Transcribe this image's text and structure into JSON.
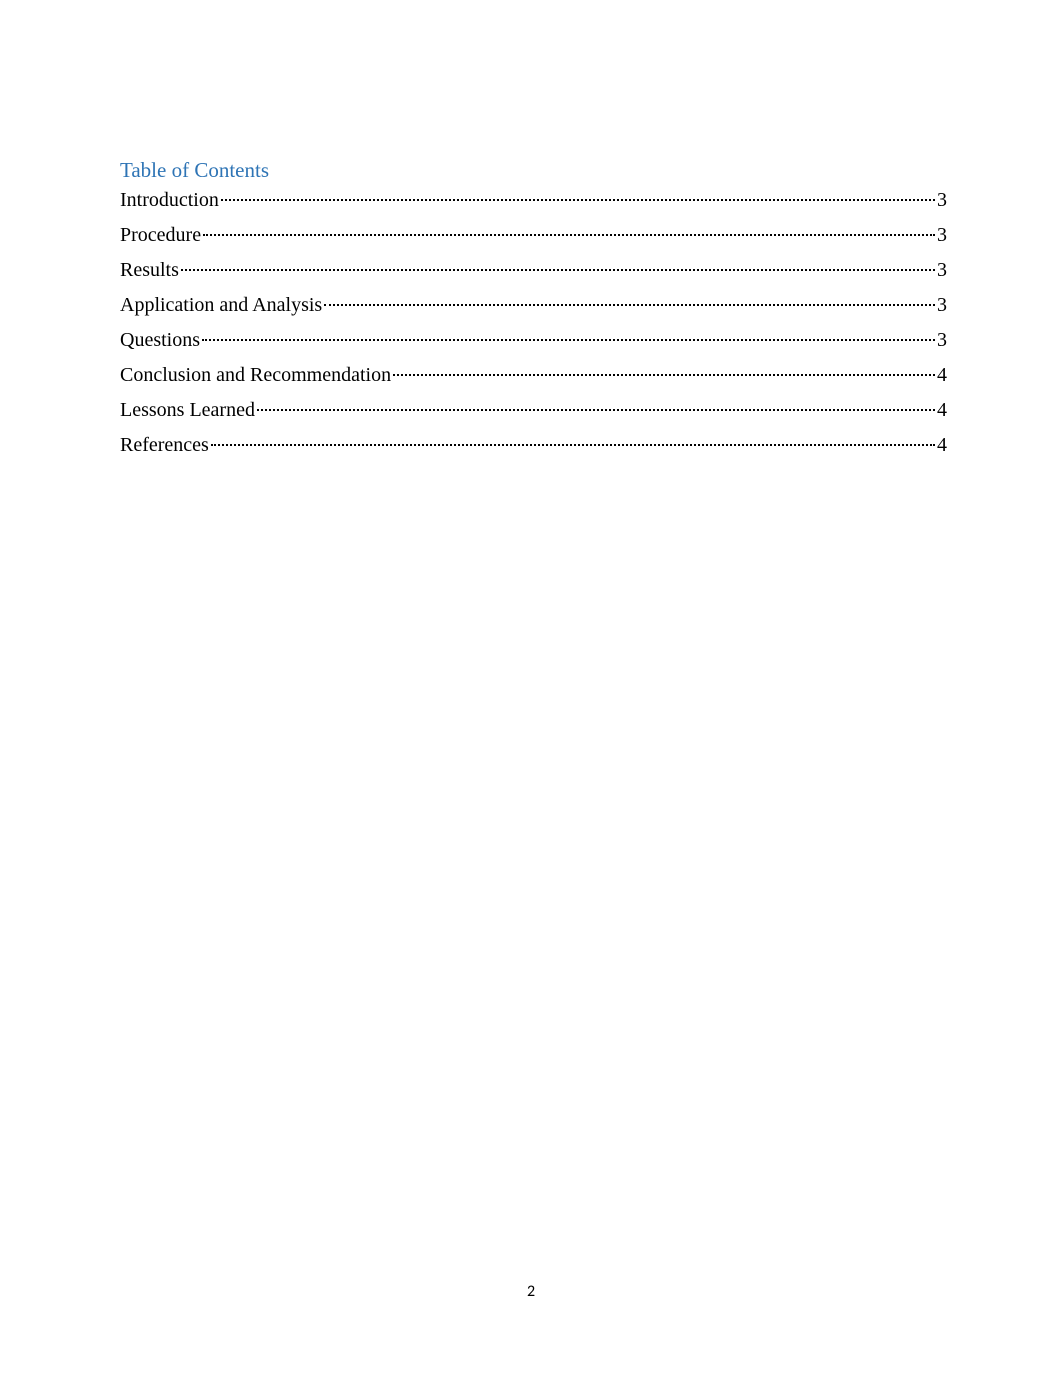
{
  "heading": "Table of Contents",
  "entries": [
    {
      "title": "Introduction",
      "page": "3"
    },
    {
      "title": "Procedure",
      "page": "3"
    },
    {
      "title": "Results",
      "page": "3"
    },
    {
      "title": "Application and Analysis",
      "page": "3"
    },
    {
      "title": "Questions",
      "page": "3"
    },
    {
      "title": "Conclusion and Recommendation",
      "page": "4"
    },
    {
      "title": "Lessons Learned",
      "page": "4"
    },
    {
      "title": "References",
      "page": "4"
    }
  ],
  "pageNumber": "2"
}
